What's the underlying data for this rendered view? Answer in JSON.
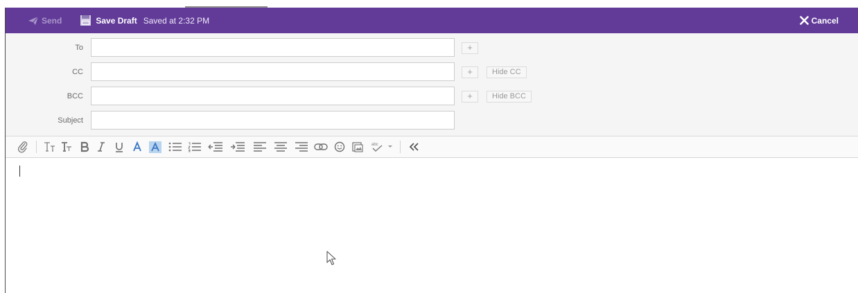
{
  "toolbar": {
    "send_label": "Send",
    "save_draft_label": "Save Draft",
    "saved_status": "Saved at 2:32 PM",
    "cancel_label": "Cancel"
  },
  "fields": {
    "to_label": "To",
    "cc_label": "CC",
    "bcc_label": "BCC",
    "subject_label": "Subject",
    "to_value": "",
    "cc_value": "",
    "bcc_value": "",
    "subject_value": "",
    "hide_cc_label": "Hide CC",
    "hide_bcc_label": "Hide BCC",
    "plus_glyph": "+"
  },
  "format_bar": {
    "tools": [
      "attach-icon",
      "font-size-icon",
      "font-family-icon",
      "bold-icon",
      "italic-icon",
      "underline-icon",
      "text-color-icon",
      "highlight-color-icon",
      "bulleted-list-icon",
      "numbered-list-icon",
      "outdent-icon",
      "indent-icon",
      "align-left-icon",
      "align-center-icon",
      "align-right-icon",
      "link-icon",
      "emoji-icon",
      "insert-image-icon",
      "spellcheck-icon",
      "dropdown-caret-icon",
      "collapse-toolbar-icon"
    ]
  },
  "editor": {
    "body": ""
  },
  "colors": {
    "toolbar_bg": "#623b99",
    "fields_bg": "#f5f5f5",
    "icon_gray": "#7f7f7f",
    "accent_blue": "#3a77c4"
  }
}
